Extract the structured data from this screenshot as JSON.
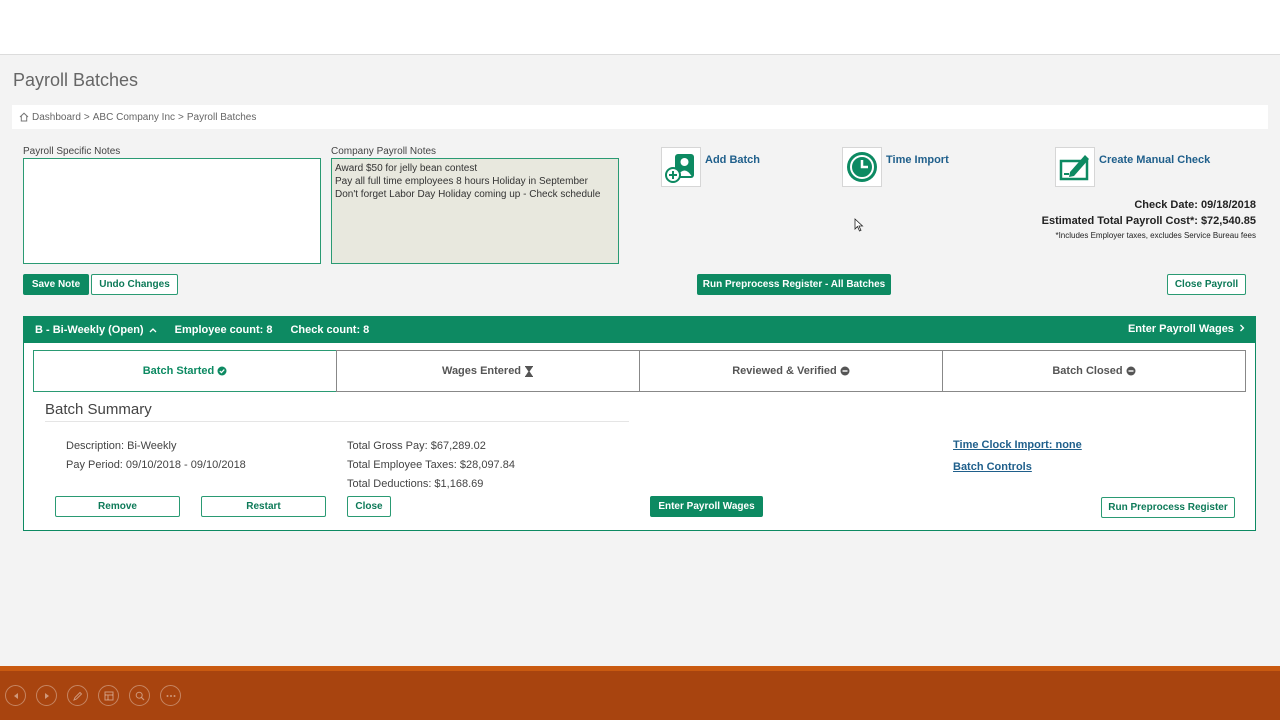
{
  "page": {
    "title": "Payroll Batches"
  },
  "breadcrumb": {
    "items": [
      "Dashboard",
      "ABC Company Inc",
      "Payroll Batches"
    ],
    "separator": ">"
  },
  "notes": {
    "specific_label": "Payroll Specific Notes",
    "specific_value": "",
    "company_label": "Company Payroll Notes",
    "company_value": "Award $50 for jelly bean contest\nPay all full time employees 8 hours Holiday in September\nDon't forget Labor Day Holiday coming up - Check schedule"
  },
  "buttons": {
    "save_note": "Save Note",
    "undo_changes": "Undo Changes",
    "run_preprocess_all": "Run Preprocess Register - All Batches",
    "close_payroll": "Close Payroll"
  },
  "actions": {
    "add_batch": "Add Batch",
    "time_import": "Time Import",
    "create_manual_check": "Create Manual Check"
  },
  "check_info": {
    "check_date": "Check Date: 09/18/2018",
    "estimated_cost": "Estimated Total Payroll Cost*: $72,540.85",
    "footnote": "*Includes Employer taxes, excludes Service Bureau fees"
  },
  "batch": {
    "name": "B - Bi-Weekly (Open)",
    "employee_count": "Employee count: 8",
    "check_count": "Check count: 8",
    "enter_wages_link": "Enter Payroll Wages",
    "steps": [
      {
        "label": "Batch Started",
        "icon": "check-circle-icon"
      },
      {
        "label": "Wages Entered",
        "icon": "hourglass-icon"
      },
      {
        "label": "Reviewed & Verified",
        "icon": "minus-circle-icon"
      },
      {
        "label": "Batch Closed",
        "icon": "minus-circle-icon"
      }
    ],
    "summary": {
      "title": "Batch Summary",
      "description": "Description: Bi-Weekly",
      "pay_period": "Pay Period: 09/10/2018 - 09/10/2018",
      "gross_pay": "Total Gross Pay: $67,289.02",
      "employee_taxes": "Total Employee Taxes: $28,097.84",
      "deductions": "Total Deductions: $1,168.69",
      "time_clock_import": "Time Clock Import: none",
      "batch_controls": "Batch Controls"
    },
    "buttons": {
      "remove": "Remove",
      "restart": "Restart",
      "close": "Close",
      "enter_payroll_wages": "Enter Payroll Wages",
      "run_preprocess": "Run Preprocess Register"
    }
  },
  "colors": {
    "brand_green": "#0d8a62",
    "link_blue": "#1f5f8b",
    "footer_orange": "#a8440f"
  }
}
